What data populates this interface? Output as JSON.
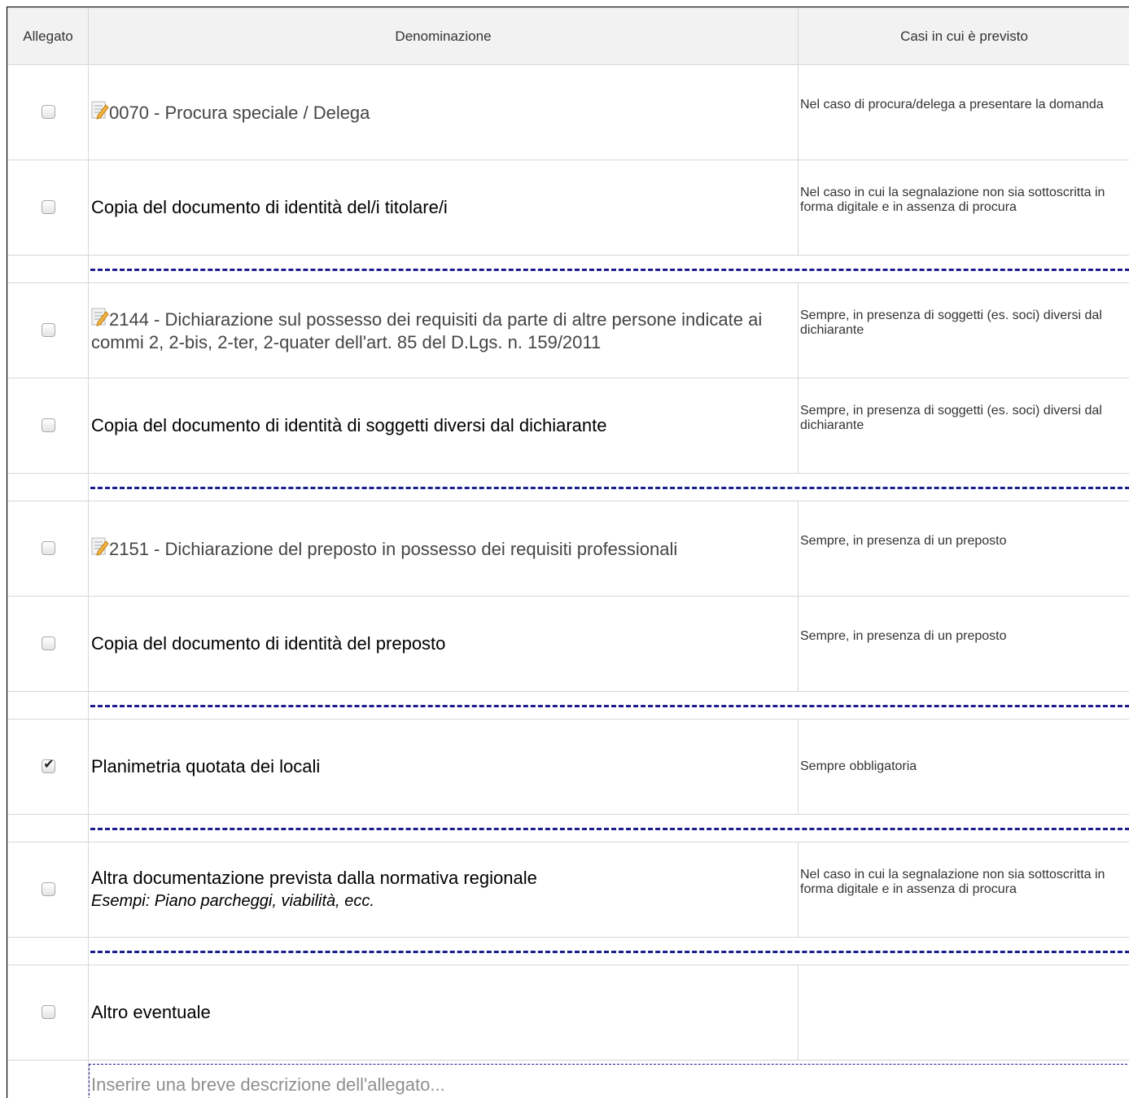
{
  "table": {
    "headers": {
      "col1": "Allegato",
      "col2": "Denominazione",
      "col3": "Casi in cui è previsto"
    },
    "rows": [
      {
        "checked": false,
        "has_icon": true,
        "name": "0070 - Procura speciale / Delega",
        "cases": "Nel caso di procura/delega a presentare la domanda"
      },
      {
        "checked": false,
        "has_icon": false,
        "name": "Copia del documento di identità del/i titolare/i",
        "cases": "Nel caso in cui la segnalazione non sia sottoscritta in forma digitale e in assenza di procura"
      },
      {
        "checked": false,
        "has_icon": true,
        "name": "2144 - Dichiarazione sul possesso dei requisiti da parte di altre persone indicate ai commi 2, 2-bis, 2-ter, 2-quater dell'art. 85 del D.Lgs. n. 159/2011",
        "cases": "Sempre, in presenza di soggetti (es. soci) diversi dal dichiarante"
      },
      {
        "checked": false,
        "has_icon": false,
        "name": "Copia del documento di identità di soggetti diversi dal dichiarante",
        "cases": "Sempre, in presenza di soggetti (es. soci) diversi dal dichiarante"
      },
      {
        "checked": false,
        "has_icon": true,
        "name": "2151 - Dichiarazione del preposto in possesso dei requisiti professionali",
        "cases": "Sempre, in presenza di un preposto"
      },
      {
        "checked": false,
        "has_icon": false,
        "name": "Copia del documento di identità del preposto",
        "cases": "Sempre, in presenza di un preposto"
      },
      {
        "checked": true,
        "has_icon": false,
        "name": "Planimetria quotata dei locali",
        "cases": "Sempre obbligatoria"
      },
      {
        "checked": false,
        "has_icon": false,
        "name": "Altra documentazione prevista dalla normativa regionale",
        "example": "Esempi: Piano parcheggi, viabilità, ecc.",
        "cases": "Nel caso in cui la segnalazione non sia sottoscritta in forma digitale e in assenza di procura"
      },
      {
        "checked": false,
        "has_icon": false,
        "name": "Altro eventuale",
        "cases": ""
      }
    ],
    "description_input": {
      "placeholder": "Inserire una breve descrizione dell'allegato...",
      "value": ""
    }
  },
  "icons": {
    "document_edit": "document-edit-icon",
    "checkbox_checked": "check-mark-icon"
  },
  "colors": {
    "separator_dash": "#1c1c8f",
    "header_bg": "#f2f2f2",
    "grid_border": "#d7d7d7"
  }
}
